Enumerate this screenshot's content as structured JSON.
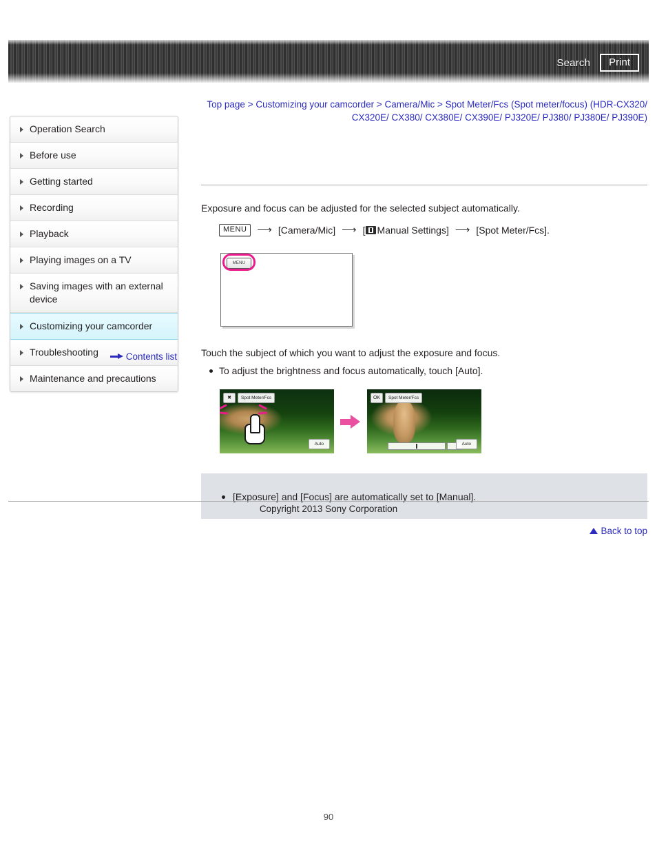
{
  "header": {
    "search_label": "Search",
    "print_label": "Print"
  },
  "breadcrumb": {
    "text": "Top page > Customizing your camcorder > Camera/Mic > Spot Meter/Fcs (Spot meter/focus) (HDR-CX320/ CX320E/ CX380/ CX380E/ CX390E/ PJ320E/ PJ380/ PJ380E/ PJ390E)"
  },
  "sidebar": {
    "items": [
      {
        "label": "Operation Search",
        "active": false
      },
      {
        "label": "Before use",
        "active": false
      },
      {
        "label": "Getting started",
        "active": false
      },
      {
        "label": "Recording",
        "active": false
      },
      {
        "label": "Playback",
        "active": false
      },
      {
        "label": "Playing images on a TV",
        "active": false
      },
      {
        "label": "Saving images with an external device",
        "active": false
      },
      {
        "label": "Customizing your camcorder",
        "active": true
      },
      {
        "label": "Troubleshooting",
        "active": false
      },
      {
        "label": "Maintenance and precautions",
        "active": false
      }
    ],
    "contents_list_label": "Contents list"
  },
  "main": {
    "intro": "Exposure and focus can be adjusted for the selected subject automatically.",
    "menu_path": {
      "menu_button": "MENU",
      "arrow": "⟶",
      "step1": "[Camera/Mic]",
      "step2_prefix": "[",
      "step2": "Manual Settings]",
      "step3": "[Spot Meter/Fcs]."
    },
    "lcd_mock": {
      "menu_button_label": "MENU"
    },
    "touch_instruction": "Touch the subject of which you want to adjust the exposure and focus.",
    "auto_bullet": "To adjust the brightness and focus automatically, touch [Auto].",
    "photo_before": {
      "close_label": "✖",
      "title_label": "Spot Meter/Fcs",
      "auto_label": "Auto"
    },
    "photo_after": {
      "ok_label": "OK",
      "title_label": "Spot Meter/Fcs",
      "auto_label": "Auto"
    },
    "note": "[Exposure] and [Focus] are automatically set to [Manual].",
    "back_to_top": "Back to top"
  },
  "footer": {
    "copyright": "Copyright 2013 Sony Corporation",
    "page_number": "90"
  }
}
